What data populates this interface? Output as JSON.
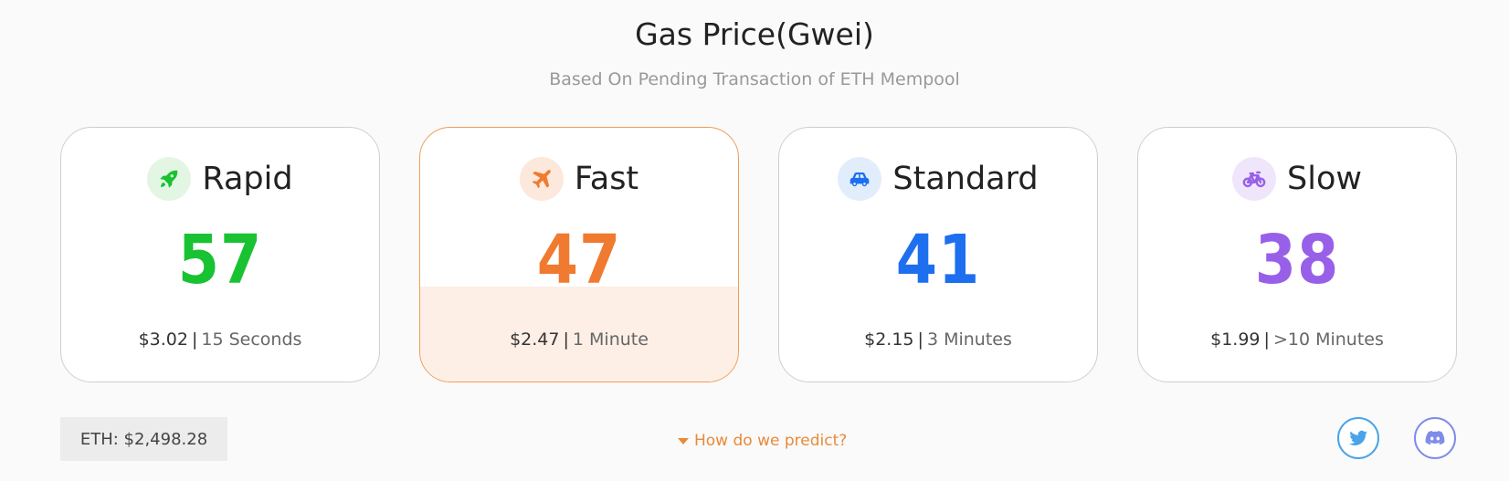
{
  "header": {
    "title": "Gas Price(Gwei)",
    "subtitle": "Based On Pending Transaction of ETH Mempool"
  },
  "cards": [
    {
      "label": "Rapid",
      "icon": "rocket-icon",
      "value": "57",
      "price": "$3.02",
      "separator": "|",
      "time": "15 Seconds",
      "color": "#19c232",
      "icon_bg": "#e3f6e3"
    },
    {
      "label": "Fast",
      "icon": "airplane-icon",
      "value": "47",
      "price": "$2.47",
      "separator": "|",
      "time": "1 Minute",
      "color": "#f07a30",
      "icon_bg": "#fde8dc"
    },
    {
      "label": "Standard",
      "icon": "car-icon",
      "value": "41",
      "price": "$2.15",
      "separator": "|",
      "time": "3 Minutes",
      "color": "#1d6ff0",
      "icon_bg": "#e2edfc"
    },
    {
      "label": "Slow",
      "icon": "bicycle-icon",
      "value": "38",
      "price": "$1.99",
      "separator": "|",
      "time": ">10 Minutes",
      "color": "#9860e8",
      "icon_bg": "#efe6fc"
    }
  ],
  "footer": {
    "eth_price": "ETH: $2,498.28",
    "predict_link": "How do we predict?",
    "twitter_color": "#4aa3e8",
    "discord_color": "#7f8ce8",
    "social_icons": [
      "twitter-icon",
      "discord-icon"
    ]
  }
}
